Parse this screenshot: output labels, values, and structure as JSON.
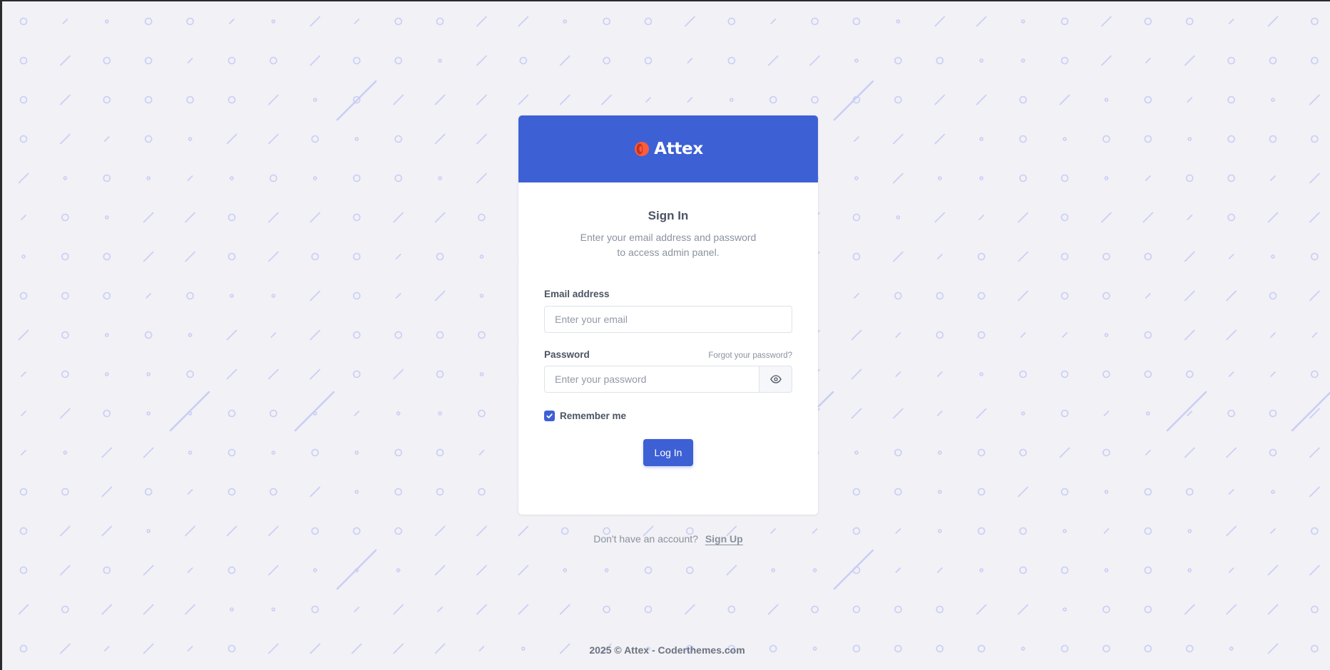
{
  "brand": {
    "name": "Attex",
    "logo_colors": [
      "#fa5c3c",
      "#e8491d"
    ]
  },
  "colors": {
    "primary": "#3e60d5",
    "background": "#f1f1f6",
    "pattern": "#c9cdf5"
  },
  "header": {
    "title": "Sign In",
    "subtitle_line1": "Enter your email address and password",
    "subtitle_line2": "to access admin panel."
  },
  "form": {
    "email": {
      "label": "Email address",
      "placeholder": "Enter your email",
      "value": ""
    },
    "password": {
      "label": "Password",
      "placeholder": "Enter your password",
      "value": "",
      "forgot_link": "Forgot your password?",
      "toggle_icon": "eye-icon"
    },
    "remember": {
      "label": "Remember me",
      "checked": true
    },
    "submit_label": "Log In"
  },
  "signup": {
    "prompt": "Don't have an account?",
    "link": "Sign Up"
  },
  "footer": {
    "text": "2025 © Attex - Coderthemes.com"
  }
}
